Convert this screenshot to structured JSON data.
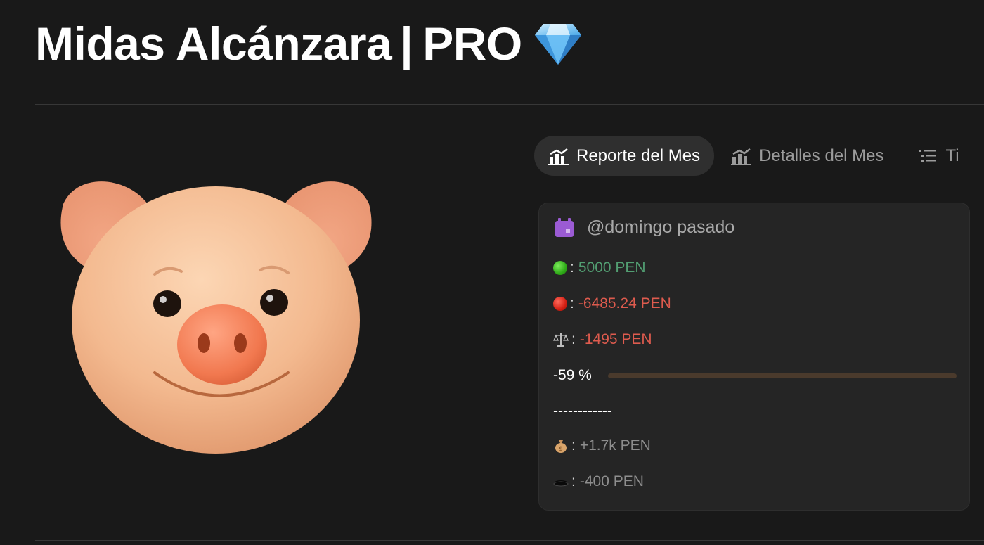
{
  "page": {
    "title_name": "Midas Alcánzara",
    "title_sep": "|",
    "title_tier": "PRO"
  },
  "tabs": [
    {
      "label": "Reporte del Mes",
      "icon": "chart-icon",
      "active": true
    },
    {
      "label": "Detalles del Mes",
      "icon": "chart-icon",
      "active": false
    },
    {
      "label": "Ti",
      "icon": "list-icon",
      "active": false
    }
  ],
  "report": {
    "date_label": "@domingo pasado",
    "income": {
      "icon": "green-circle-icon",
      "value": "5000 PEN"
    },
    "expenses": {
      "icon": "red-circle-icon",
      "value": "-6485.24 PEN"
    },
    "balance": {
      "icon": "scales-icon",
      "value": "-1495 PEN"
    },
    "percent_label": "-59 %",
    "percent_fill": 0,
    "separator": "------------",
    "savings": {
      "icon": "money-bag-icon",
      "value": "+1.7k PEN"
    },
    "debt": {
      "icon": "hole-icon",
      "value": "-400 PEN"
    }
  },
  "colors": {
    "background": "#191919",
    "card": "#252525",
    "positive": "#529e72",
    "negative": "#de5b4e",
    "bar_track": "#4a3a2c"
  }
}
